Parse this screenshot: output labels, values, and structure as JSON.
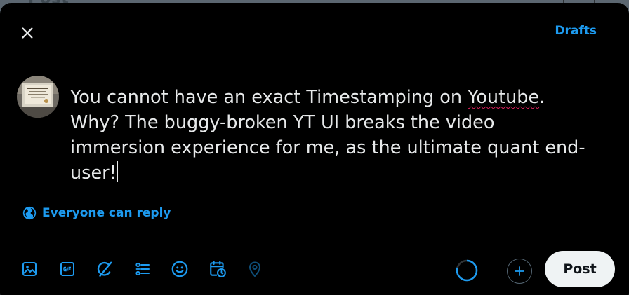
{
  "backdrop": {
    "title": "Post"
  },
  "header": {
    "drafts_label": "Drafts"
  },
  "composer": {
    "text_before": "You cannot have an exact Timestamping on ",
    "misspelled_word": "Youtube",
    "text_after": ". Why? The buggy-broken YT UI breaks the video immersion experience for me, as the ultimate quant end-user!"
  },
  "reply_setting": {
    "label": "Everyone can reply"
  },
  "footer": {
    "post_label": "Post"
  },
  "colors": {
    "accent": "#1d9bf0",
    "background": "#000000",
    "text": "#e7e9ea",
    "post_button": "#eff3f4"
  },
  "icons": [
    "close-icon",
    "globe-icon",
    "image-icon",
    "gif-icon",
    "grok-icon",
    "poll-icon",
    "emoji-icon",
    "schedule-icon",
    "location-icon",
    "plus-icon"
  ]
}
